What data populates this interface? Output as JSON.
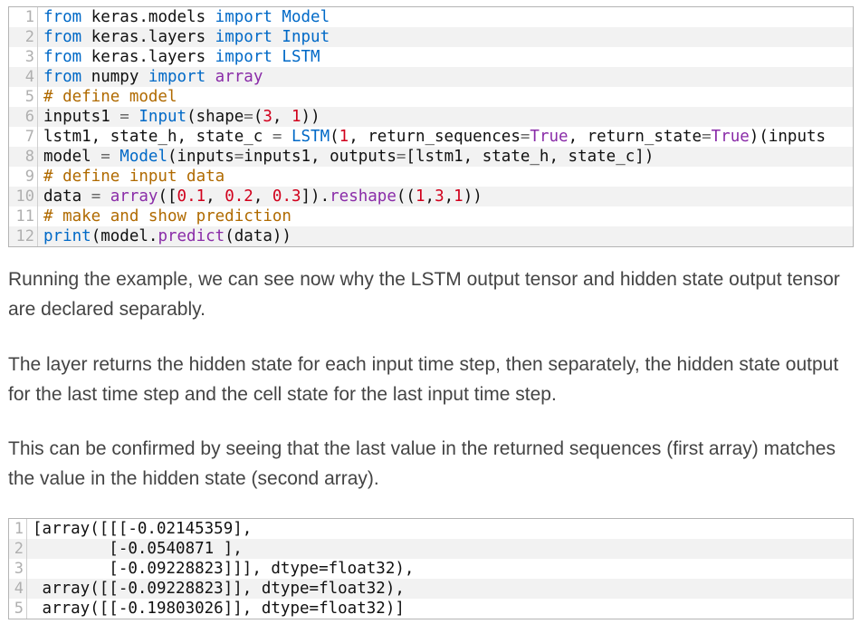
{
  "code_block_1": {
    "lines": [
      {
        "num": "1",
        "tokens": [
          {
            "t": "from",
            "c": "kw"
          },
          {
            "t": " keras.models ",
            "c": "plain"
          },
          {
            "t": "import",
            "c": "kw"
          },
          {
            "t": " Model",
            "c": "cls"
          }
        ]
      },
      {
        "num": "2",
        "tokens": [
          {
            "t": "from",
            "c": "kw"
          },
          {
            "t": " keras.layers ",
            "c": "plain"
          },
          {
            "t": "import",
            "c": "kw"
          },
          {
            "t": " Input",
            "c": "cls"
          }
        ]
      },
      {
        "num": "3",
        "tokens": [
          {
            "t": "from",
            "c": "kw"
          },
          {
            "t": " keras.layers ",
            "c": "plain"
          },
          {
            "t": "import",
            "c": "kw"
          },
          {
            "t": " LSTM",
            "c": "cls"
          }
        ]
      },
      {
        "num": "4",
        "tokens": [
          {
            "t": "from",
            "c": "kw"
          },
          {
            "t": " numpy ",
            "c": "plain"
          },
          {
            "t": "import",
            "c": "kw"
          },
          {
            "t": " array",
            "c": "fn"
          }
        ]
      },
      {
        "num": "5",
        "tokens": [
          {
            "t": "# define model",
            "c": "cm"
          }
        ]
      },
      {
        "num": "6",
        "tokens": [
          {
            "t": "inputs1 ",
            "c": "plain"
          },
          {
            "t": "=",
            "c": "op"
          },
          {
            "t": " Input",
            "c": "cls"
          },
          {
            "t": "(shape",
            "c": "plain"
          },
          {
            "t": "=",
            "c": "op"
          },
          {
            "t": "(",
            "c": "plain"
          },
          {
            "t": "3",
            "c": "num"
          },
          {
            "t": ", ",
            "c": "plain"
          },
          {
            "t": "1",
            "c": "num"
          },
          {
            "t": "))",
            "c": "plain"
          }
        ]
      },
      {
        "num": "7",
        "tokens": [
          {
            "t": "lstm1, state_h, state_c ",
            "c": "plain"
          },
          {
            "t": "=",
            "c": "op"
          },
          {
            "t": " LSTM",
            "c": "cls"
          },
          {
            "t": "(",
            "c": "plain"
          },
          {
            "t": "1",
            "c": "num"
          },
          {
            "t": ", return_sequences",
            "c": "plain"
          },
          {
            "t": "=",
            "c": "op"
          },
          {
            "t": "True",
            "c": "fn"
          },
          {
            "t": ", return_state",
            "c": "plain"
          },
          {
            "t": "=",
            "c": "op"
          },
          {
            "t": "True",
            "c": "fn"
          },
          {
            "t": ")(inputs",
            "c": "plain"
          }
        ]
      },
      {
        "num": "8",
        "tokens": [
          {
            "t": "model ",
            "c": "plain"
          },
          {
            "t": "=",
            "c": "op"
          },
          {
            "t": " Model",
            "c": "cls"
          },
          {
            "t": "(inputs",
            "c": "plain"
          },
          {
            "t": "=",
            "c": "op"
          },
          {
            "t": "inputs1, outputs",
            "c": "plain"
          },
          {
            "t": "=",
            "c": "op"
          },
          {
            "t": "[lstm1, state_h, state_c])",
            "c": "plain"
          }
        ]
      },
      {
        "num": "9",
        "tokens": [
          {
            "t": "# define input data",
            "c": "cm"
          }
        ]
      },
      {
        "num": "10",
        "tokens": [
          {
            "t": "data ",
            "c": "plain"
          },
          {
            "t": "=",
            "c": "op"
          },
          {
            "t": " array",
            "c": "fn"
          },
          {
            "t": "([",
            "c": "plain"
          },
          {
            "t": "0.1",
            "c": "num"
          },
          {
            "t": ", ",
            "c": "plain"
          },
          {
            "t": "0.2",
            "c": "num"
          },
          {
            "t": ", ",
            "c": "plain"
          },
          {
            "t": "0.3",
            "c": "num"
          },
          {
            "t": "]).",
            "c": "plain"
          },
          {
            "t": "reshape",
            "c": "fn"
          },
          {
            "t": "((",
            "c": "plain"
          },
          {
            "t": "1",
            "c": "num"
          },
          {
            "t": ",",
            "c": "plain"
          },
          {
            "t": "3",
            "c": "num"
          },
          {
            "t": ",",
            "c": "plain"
          },
          {
            "t": "1",
            "c": "num"
          },
          {
            "t": "))",
            "c": "plain"
          }
        ]
      },
      {
        "num": "11",
        "tokens": [
          {
            "t": "# make and show prediction",
            "c": "cm"
          }
        ]
      },
      {
        "num": "12",
        "tokens": [
          {
            "t": "print",
            "c": "cls"
          },
          {
            "t": "(model.",
            "c": "plain"
          },
          {
            "t": "predict",
            "c": "fn"
          },
          {
            "t": "(data))",
            "c": "plain"
          }
        ]
      }
    ]
  },
  "paragraphs": [
    "Running the example, we can see now why the LSTM output tensor and hidden state output tensor are declared separably.",
    "The layer returns the hidden state for each input time step, then separately, the hidden state output for the last time step and the cell state for the last input time step.",
    "This can be confirmed by seeing that the last value in the returned sequences (first array) matches the value in the hidden state (second array)."
  ],
  "code_block_2": {
    "lines": [
      {
        "num": "1",
        "tokens": [
          {
            "t": "[array([[[-0.02145359],",
            "c": "plain"
          }
        ]
      },
      {
        "num": "2",
        "tokens": [
          {
            "t": "        [-0.0540871 ],",
            "c": "plain"
          }
        ]
      },
      {
        "num": "3",
        "tokens": [
          {
            "t": "        [-0.09228823]]], dtype=float32),",
            "c": "plain"
          }
        ]
      },
      {
        "num": "4",
        "tokens": [
          {
            "t": " array([[-0.09228823]], dtype=float32),",
            "c": "plain"
          }
        ]
      },
      {
        "num": "5",
        "tokens": [
          {
            "t": " array([[-0.19803026]], dtype=float32)]",
            "c": "plain"
          }
        ]
      }
    ]
  }
}
